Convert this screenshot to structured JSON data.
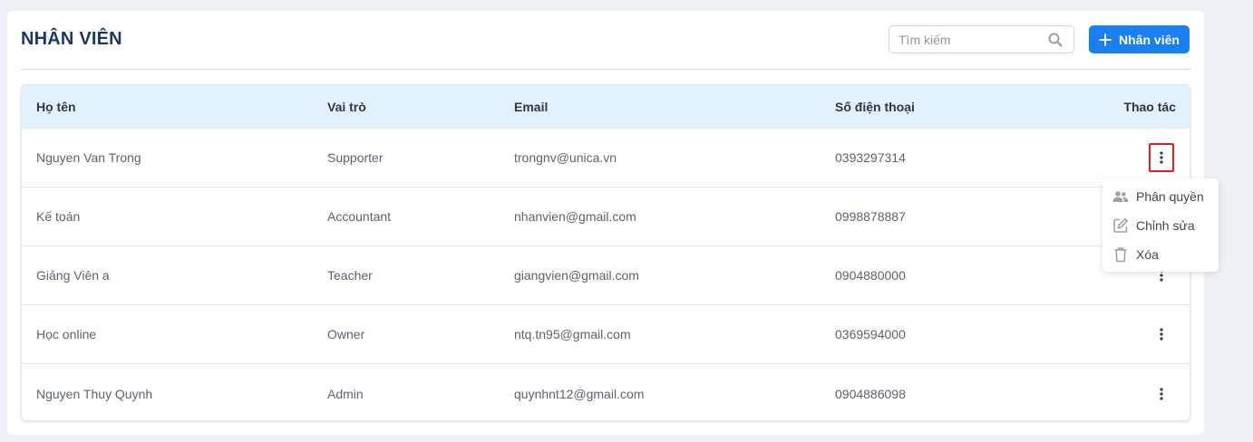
{
  "header": {
    "title": "NHÂN VIÊN",
    "search_placeholder": "Tìm kiếm",
    "add_button_label": "Nhân viên"
  },
  "table": {
    "columns": [
      "Họ tên",
      "Vai trò",
      "Email",
      "Số điện thoại",
      "Thao tác"
    ],
    "rows": [
      {
        "name": "Nguyen Van Trong",
        "role": "Supporter",
        "email": "trongnv@unica.vn",
        "phone": "0393297314"
      },
      {
        "name": "Kế toán",
        "role": "Accountant",
        "email": "nhanvien@gmail.com",
        "phone": "0998878887"
      },
      {
        "name": "Giảng Viên a",
        "role": "Teacher",
        "email": "giangvien@gmail.com",
        "phone": "0904880000"
      },
      {
        "name": "Học online",
        "role": "Owner",
        "email": "ntq.tn95@gmail.com",
        "phone": "0369594000"
      },
      {
        "name": "Nguyen Thuy Quynh",
        "role": "Admin",
        "email": "quynhnt12@gmail.com",
        "phone": "0904886098"
      }
    ]
  },
  "action_menu": {
    "items": [
      {
        "label": "Phân quyền",
        "icon": "people-icon"
      },
      {
        "label": "Chỉnh sửa",
        "icon": "edit-icon"
      },
      {
        "label": "Xóa",
        "icon": "trash-icon"
      }
    ]
  },
  "colors": {
    "primary": "#1a7ff0",
    "header_bg": "#e2f1fc",
    "title": "#1c3a5e",
    "highlight": "#e01e1e"
  }
}
